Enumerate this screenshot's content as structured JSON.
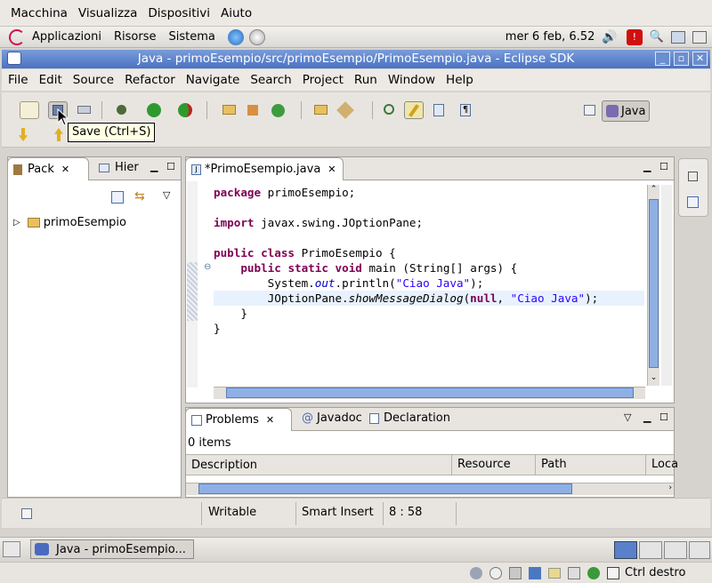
{
  "vbox_menu": [
    "Macchina",
    "Visualizza",
    "Dispositivi",
    "Aiuto"
  ],
  "gnome_panel": {
    "items": [
      "Applicazioni",
      "Risorse",
      "Sistema"
    ],
    "clock": "mer  6 feb, 6.52"
  },
  "window": {
    "title": "Java - primoEsempio/src/primoEsempio/PrimoEsempio.java - Eclipse SDK"
  },
  "menubar": [
    "File",
    "Edit",
    "Source",
    "Refactor",
    "Navigate",
    "Search",
    "Project",
    "Run",
    "Window",
    "Help"
  ],
  "tooltip": "Save (Ctrl+S)",
  "perspective": {
    "label": "Java"
  },
  "explorer": {
    "tab_active": "Pack",
    "tab_other": "Hier",
    "tree": [
      {
        "label": "primoEsempio",
        "expanded": false
      }
    ]
  },
  "editor": {
    "tab_label": "*PrimoEsempio.java",
    "code": [
      [
        {
          "t": "package",
          "c": "kw"
        },
        {
          "t": " primoEsempio;"
        }
      ],
      [],
      [
        {
          "t": "import",
          "c": "kw"
        },
        {
          "t": " javax.swing.JOptionPane;"
        }
      ],
      [],
      [
        {
          "t": "public",
          "c": "kw"
        },
        {
          "t": " "
        },
        {
          "t": "class",
          "c": "kw"
        },
        {
          "t": " PrimoEsempio {"
        }
      ],
      [
        {
          "t": "    "
        },
        {
          "t": "public",
          "c": "kw"
        },
        {
          "t": " "
        },
        {
          "t": "static",
          "c": "kw"
        },
        {
          "t": " "
        },
        {
          "t": "void",
          "c": "kw"
        },
        {
          "t": " main (String[] args) {"
        }
      ],
      [
        {
          "t": "        System."
        },
        {
          "t": "out",
          "c": "fld"
        },
        {
          "t": ".println("
        },
        {
          "t": "\"Ciao Java\"",
          "c": "str"
        },
        {
          "t": ");"
        }
      ],
      [
        {
          "t": "        JOptionPane."
        },
        {
          "t": "showMessageDialog",
          "c": "ital"
        },
        {
          "t": "("
        },
        {
          "t": "null",
          "c": "kw"
        },
        {
          "t": ", "
        },
        {
          "t": "\"Ciao Java\"",
          "c": "str"
        },
        {
          "t": ");"
        }
      ],
      [
        {
          "t": "    }"
        }
      ],
      [
        {
          "t": "}"
        }
      ]
    ]
  },
  "bottom": {
    "tabs": [
      "Problems",
      "Javadoc",
      "Declaration"
    ],
    "count": "0 items",
    "columns": [
      "Description",
      "Resource",
      "Path",
      "Loca"
    ]
  },
  "status": {
    "writable": "Writable",
    "insert_mode": "Smart Insert",
    "position": "8 : 58"
  },
  "taskbar": {
    "task": "Java - primoEsempio..."
  },
  "vbox_status": {
    "host_key": "Ctrl destro"
  },
  "colors": {
    "keyword": "#7f0055",
    "string": "#2a00ff",
    "field": "#0000c0",
    "title_bar": "#5a80cc"
  }
}
